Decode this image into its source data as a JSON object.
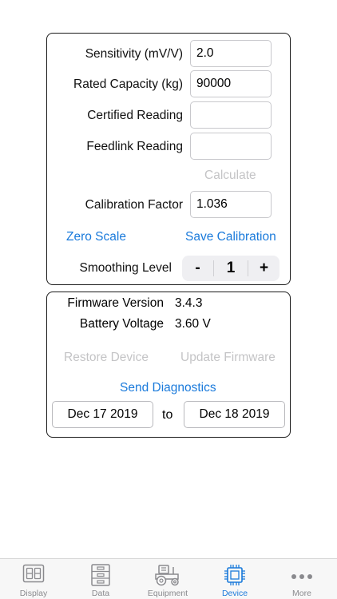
{
  "calibration": {
    "sensitivity_label": "Sensitivity (mV/V)",
    "sensitivity_value": "2.0",
    "capacity_label": "Rated Capacity (kg)",
    "capacity_value": "90000",
    "certified_label": "Certified Reading",
    "certified_value": "",
    "feedlink_label": "Feedlink Reading",
    "feedlink_value": "",
    "calculate_label": "Calculate",
    "factor_label": "Calibration Factor",
    "factor_value": "1.036",
    "zero_scale_label": "Zero Scale",
    "save_calibration_label": "Save Calibration",
    "smoothing_label": "Smoothing Level",
    "smoothing_minus": "-",
    "smoothing_value": "1",
    "smoothing_plus": "+"
  },
  "device": {
    "firmware_label": "Firmware Version",
    "firmware_value": "3.4.3",
    "battery_label": "Battery Voltage",
    "battery_value": "3.60 V",
    "restore_label": "Restore Device",
    "update_label": "Update Firmware",
    "diagnostics_label": "Send Diagnostics",
    "date_from": "Dec 17 2019",
    "date_to_word": "to",
    "date_to": "Dec 18 2019"
  },
  "tabbar": {
    "items": [
      {
        "label": "Display",
        "icon": "display-icon"
      },
      {
        "label": "Data",
        "icon": "data-cabinet-icon"
      },
      {
        "label": "Equipment",
        "icon": "tractor-icon"
      },
      {
        "label": "Device",
        "icon": "chip-icon"
      },
      {
        "label": "More",
        "icon": "more-dots-icon"
      }
    ],
    "active": "Device"
  },
  "colors": {
    "accent": "#1a7adb",
    "disabled": "#c4c4c6",
    "tab_inactive": "#8a8a8e"
  }
}
